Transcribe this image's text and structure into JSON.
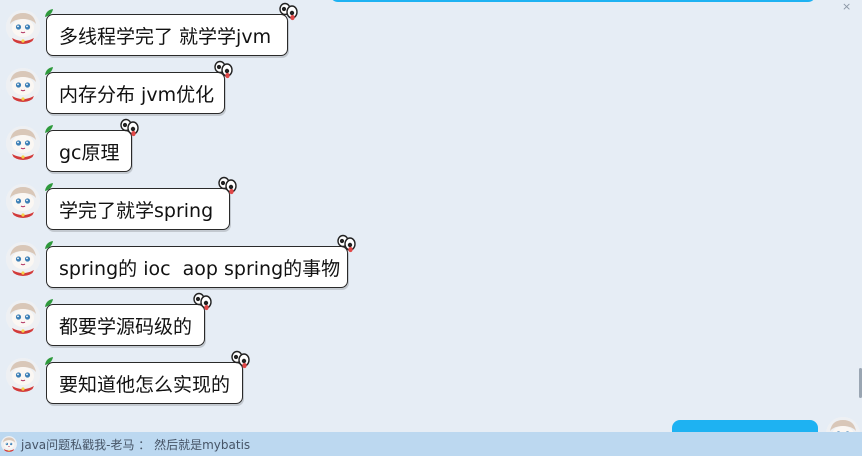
{
  "chat": {
    "messages": [
      {
        "text": "多线程学完了 就学学jvm"
      },
      {
        "text": "内存分布 jvm优化"
      },
      {
        "text": "gc原理"
      },
      {
        "text": "学完了就学spring"
      },
      {
        "text": "spring的 ioc  aop spring的事物"
      },
      {
        "text": "都要学源码级的"
      },
      {
        "text": "要知道他怎么实现的"
      }
    ]
  },
  "notification": {
    "text": "java问题私戳我-老马 ： 然后就是mybatis"
  },
  "window": {
    "close_glyph": "×"
  },
  "icons": {
    "avatar": "cartoon-avatar-icon",
    "bubble_decoration": "googly-eyes-icon",
    "leaf": "leaf-icon"
  },
  "colors": {
    "background": "#e6edf5",
    "self_bubble": "#1eb2f2",
    "notification_bar": "#bcd8f0"
  }
}
